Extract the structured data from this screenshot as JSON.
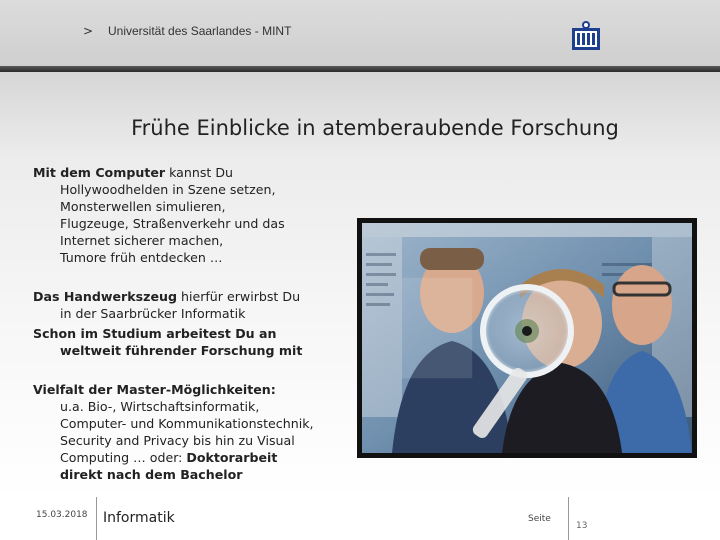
{
  "header": {
    "chevron": ">",
    "institution": "Universität des Saarlandes - MINT",
    "logo_icon": "saarland-university-seal-icon"
  },
  "slide": {
    "title": "Frühe Einblicke in atemberaubende Forschung",
    "block1": {
      "bold": "Mit dem Computer",
      "line1_rest": " kannst Du",
      "lines": [
        "Hollywoodhelden in Szene setzen,",
        "Monsterwellen simulieren,",
        "Flugzeuge, Straßenverkehr und das",
        "Internet sicherer machen,",
        "Tumore früh entdecken …"
      ]
    },
    "block2": {
      "bold": "Das Handwerkszeug",
      "line1_rest": " hierfür erwirbst Du",
      "line2": "in der Saarbrücker Informatik"
    },
    "block3": {
      "line1": "Schon im Studium arbeitest Du an",
      "line2": "weltweit führender Forschung mit"
    },
    "block4": {
      "heading": "Vielfalt der Master-Möglichkeiten:",
      "lines": [
        "u.a. Bio-, Wirtschaftsinformatik,",
        "Computer- und Kommunikationstechnik,",
        "Security and Privacy bis hin zu Visual"
      ],
      "line_mixed_prefix": "Computing … oder: ",
      "line_mixed_bold": "Doktorarbeit",
      "last_bold": "direkt nach dem Bachelor"
    },
    "photo_icon": "researchers-magnifying-glass-photo"
  },
  "footer": {
    "date": "15.03.2018",
    "department": "Informatik",
    "page_label": "Seite",
    "page_number": "13"
  },
  "colors": {
    "header_bg": "#d4d4d4",
    "header_bar": "#333333",
    "logo_blue": "#1f3f8f"
  }
}
